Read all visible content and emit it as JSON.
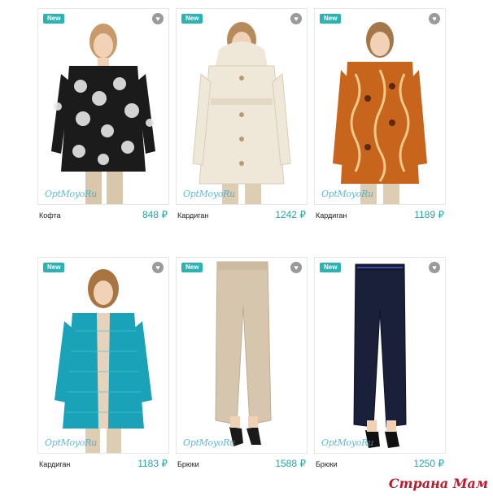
{
  "products": [
    {
      "badge": "New",
      "name": "Кофта",
      "price": "848 ₽",
      "brand": "OptMoyoRu",
      "garment": "black-floral-cardigan",
      "color": "#1b1b1b"
    },
    {
      "badge": "New",
      "name": "Кардиган",
      "price": "1242 ₽",
      "brand": "OptMoyoRu",
      "garment": "cream-belted-cardigan",
      "color": "#efe7d8"
    },
    {
      "badge": "New",
      "name": "Кардиган",
      "price": "1189 ₽",
      "brand": "OptMoyoRu",
      "garment": "orange-pattern-cardigan",
      "color": "#c8651d"
    },
    {
      "badge": "New",
      "name": "Кардиган",
      "price": "1183 ₽",
      "brand": "OptMoyoRu",
      "garment": "turquoise-knit-cardigan",
      "color": "#1aa3b8"
    },
    {
      "badge": "New",
      "name": "Брюки",
      "price": "1588 ₽",
      "brand": "OptMoyoRu",
      "garment": "beige-trousers",
      "color": "#d6c6ad"
    },
    {
      "badge": "New",
      "name": "Брюки",
      "price": "1250 ₽",
      "brand": "OptMoyoRu",
      "garment": "navy-trousers",
      "color": "#1a1f3a"
    }
  ],
  "watermark": "Страна Мам",
  "icons": {
    "favorite": "heart-icon"
  }
}
